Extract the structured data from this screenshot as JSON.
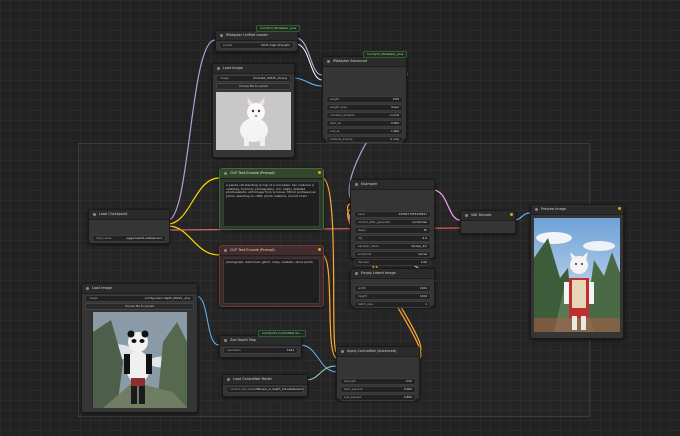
{
  "nodes": {
    "ipa_unified_loader": {
      "badge": "ComfyUI_IPAdapter_plus",
      "title": "IPAdapter Unified Loader",
      "widgets": [
        {
          "label": "preset",
          "value": "PLUS (high strength)"
        }
      ]
    },
    "load_image_top": {
      "title": "Load Image",
      "widgets": [
        {
          "label": "image",
          "value": "PortraitA_09345_10.png"
        }
      ],
      "button": "choose file to upload",
      "image_subject": "white kitten"
    },
    "ipa_advanced": {
      "badge": "ComfyUI_IPAdapter_plus",
      "title": "IPAdapter Advanced",
      "widgets": [
        {
          "label": "weight",
          "value": "0.85"
        },
        {
          "label": "weight_type",
          "value": "linear"
        },
        {
          "label": "combine_embeds",
          "value": "concat"
        },
        {
          "label": "start_at",
          "value": "0.000"
        },
        {
          "label": "end_at",
          "value": "1.000"
        },
        {
          "label": "embeds_scaling",
          "value": "V only"
        }
      ]
    },
    "clip_pos": {
      "title": "CLIP Text Encode (Prompt)",
      "text": "a panda cat standing on top of a mountain, tan costume a vest/bag, full body photography, rim, highly detailed photorealistic, still image from a movie, 35mm professional photo, standing on cliffs, photo realtime, mount of art"
    },
    "clip_neg": {
      "title": "CLIP Text Encode (Prompt)",
      "text": "photograph, deformed, glitch, noisy, realistic, stock photo"
    },
    "checkpoint": {
      "title": "Load Checkpoint",
      "widgets": [
        {
          "label": "ckpt_name",
          "value": "juggernautXL.safetensors"
        }
      ]
    },
    "ksampler": {
      "title": "KSampler",
      "widgets": [
        {
          "label": "seed",
          "value": "1058477553458931"
        },
        {
          "label": "control_after_generate",
          "value": "randomize"
        },
        {
          "label": "steps",
          "value": "30"
        },
        {
          "label": "cfg",
          "value": "6.0"
        },
        {
          "label": "sampler_name",
          "value": "dpmpp_2m"
        },
        {
          "label": "scheduler",
          "value": "karras"
        },
        {
          "label": "denoise",
          "value": "1.00"
        }
      ]
    },
    "empty_latent": {
      "title": "Empty Latent Image",
      "widgets": [
        {
          "label": "width",
          "value": "1024"
        },
        {
          "label": "height",
          "value": "1024"
        },
        {
          "label": "batch_size",
          "value": "1"
        }
      ]
    },
    "vae_decode": {
      "title": "VAE Decode"
    },
    "preview": {
      "title": "Preview Image"
    },
    "load_image_bottom": {
      "title": "Load Image",
      "widgets": [
        {
          "label": "image",
          "value": "comfyui-zero-depth_00021_.png"
        }
      ],
      "button": "choose file to upload",
      "image_subject": "panda"
    },
    "zoe_depth": {
      "badge": "ComfyUI's ControlNet Au...",
      "title": "Zoe Depth Map",
      "widgets": [
        {
          "label": "resolution",
          "value": "1024"
        }
      ]
    },
    "load_controlnet": {
      "title": "Load ControlNet Model",
      "widgets": [
        {
          "label": "control_net_name",
          "value": "diffusers_xl_depth_full.safetensors"
        }
      ]
    },
    "apply_controlnet": {
      "title": "Apply ControlNet (Advanced)",
      "widgets": [
        {
          "label": "strength",
          "value": "0.50"
        },
        {
          "label": "start_percent",
          "value": "0.000"
        },
        {
          "label": "end_percent",
          "value": "0.800"
        }
      ]
    }
  },
  "colors": {
    "wire_model": "#b39ddb",
    "wire_clip": "#ffd600",
    "wire_vae": "#ff6e6e",
    "wire_latent": "#ff9cf9",
    "wire_image": "#64b5f6",
    "wire_conditioning": "#ffa931",
    "wire_ipadapter": "#ffffff"
  }
}
